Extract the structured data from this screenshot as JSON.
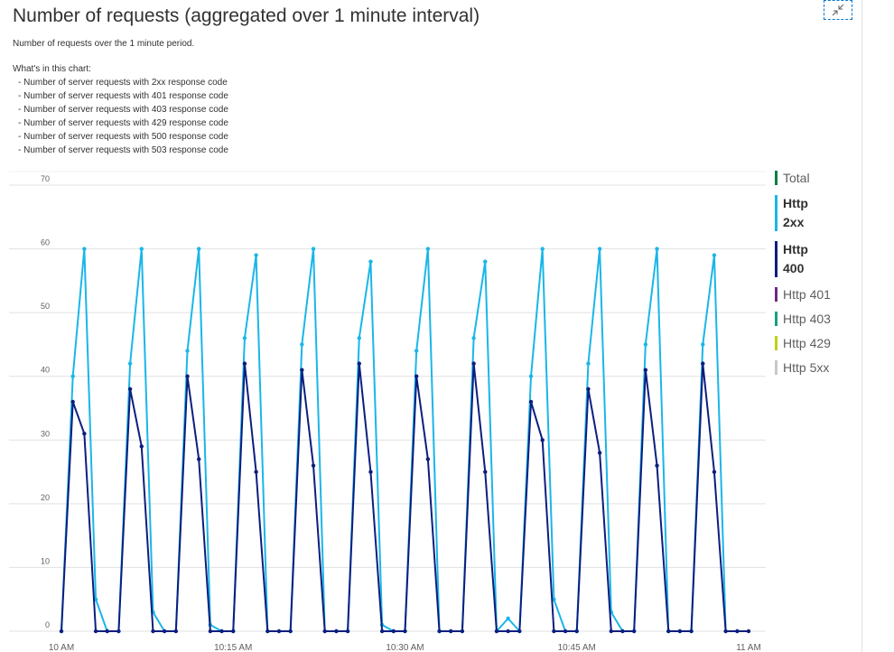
{
  "title": "Number of requests (aggregated over 1 minute interval)",
  "description": "Number of requests over the 1 minute period.",
  "whats_in_heading": "What's in this chart:",
  "whats_in_items": [
    "- Number of server requests with 2xx response code",
    "- Number of server requests with 401 response code",
    "- Number of server requests with 403 response code",
    "- Number of server requests with 429 response code",
    "- Number of server requests with 500 response code",
    "- Number of server requests with 503 response code"
  ],
  "collapse_icon": "collapse-arrows-icon",
  "legend": [
    {
      "label": "Total",
      "color": "#107c41",
      "bold": false
    },
    {
      "label": "Http 2xx",
      "color": "#1ab6e8",
      "bold": true
    },
    {
      "label": "Http 400",
      "color": "#0c1e7e",
      "bold": true
    },
    {
      "label": "Http 401",
      "color": "#6b2c82",
      "bold": false
    },
    {
      "label": "Http 403",
      "color": "#16a083",
      "bold": false
    },
    {
      "label": "Http 429",
      "color": "#bcd018",
      "bold": false
    },
    {
      "label": "Http 5xx",
      "color": "#c8c8c8",
      "bold": false
    }
  ],
  "chart_data": {
    "type": "line",
    "x_start_minute": 0,
    "x": [
      0,
      1,
      2,
      3,
      4,
      5,
      6,
      7,
      8,
      9,
      10,
      11,
      12,
      13,
      14,
      15,
      16,
      17,
      18,
      19,
      20,
      21,
      22,
      23,
      24,
      25,
      26,
      27,
      28,
      29,
      30,
      31,
      32,
      33,
      34,
      35,
      36,
      37,
      38,
      39,
      40,
      41,
      42,
      43,
      44,
      45,
      46,
      47,
      48,
      49,
      50,
      51,
      52,
      53,
      54,
      55,
      56,
      57,
      58,
      59,
      60
    ],
    "x_ticks": [
      {
        "minute": 0,
        "label": "10 AM"
      },
      {
        "minute": 15,
        "label": "10:15 AM"
      },
      {
        "minute": 30,
        "label": "10:30 AM"
      },
      {
        "minute": 45,
        "label": "10:45 AM"
      },
      {
        "minute": 60,
        "label": "11 AM"
      }
    ],
    "y_ticks": [
      0,
      10,
      20,
      30,
      40,
      50,
      60,
      70
    ],
    "ylim": [
      0,
      70
    ],
    "series": [
      {
        "name": "Http 2xx",
        "color": "#1ab6e8",
        "values": [
          0,
          40,
          60,
          5,
          0,
          0,
          42,
          60,
          3,
          0,
          0,
          44,
          60,
          1,
          0,
          0,
          46,
          59,
          0,
          0,
          0,
          45,
          60,
          0,
          0,
          0,
          46,
          58,
          1,
          0,
          0,
          44,
          60,
          0,
          0,
          0,
          46,
          58,
          0,
          2,
          0,
          40,
          60,
          5,
          0,
          0,
          42,
          60,
          3,
          0,
          0,
          45,
          60,
          0,
          0,
          0,
          45,
          59,
          0,
          0,
          null
        ]
      },
      {
        "name": "Http 400",
        "color": "#0c1e7e",
        "values": [
          0,
          36,
          31,
          0,
          0,
          0,
          38,
          29,
          0,
          0,
          0,
          40,
          27,
          0,
          0,
          0,
          42,
          25,
          0,
          0,
          0,
          41,
          26,
          0,
          0,
          0,
          42,
          25,
          0,
          0,
          0,
          40,
          27,
          0,
          0,
          0,
          42,
          25,
          0,
          0,
          0,
          36,
          30,
          0,
          0,
          0,
          38,
          28,
          0,
          0,
          0,
          41,
          26,
          0,
          0,
          0,
          42,
          25,
          0,
          0,
          0
        ]
      }
    ]
  }
}
